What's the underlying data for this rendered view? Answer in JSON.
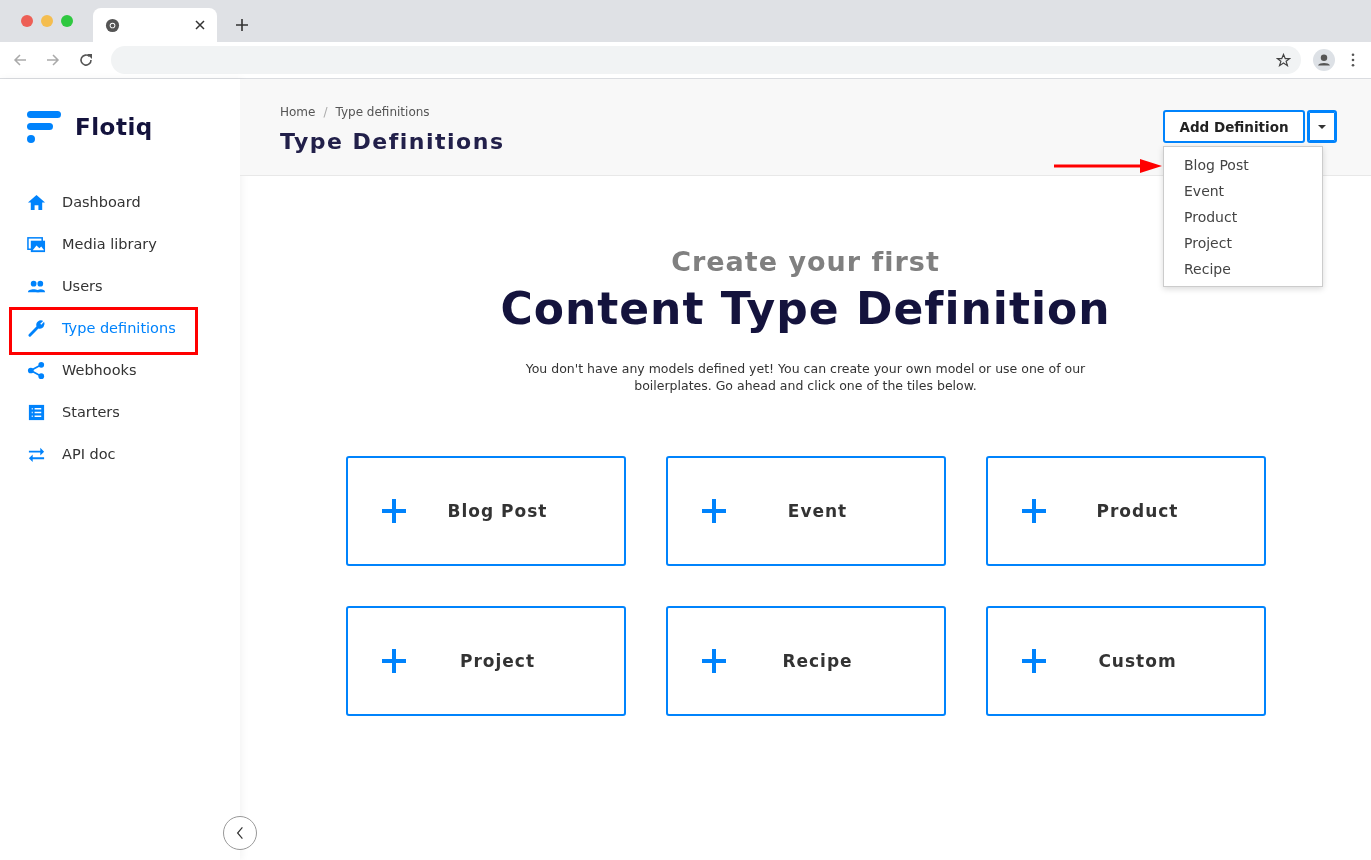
{
  "brand": {
    "name": "Flotiq"
  },
  "sidebar": {
    "items": [
      {
        "label": "Dashboard",
        "selected": false
      },
      {
        "label": "Media library",
        "selected": false
      },
      {
        "label": "Users",
        "selected": false
      },
      {
        "label": "Type definitions",
        "selected": true
      },
      {
        "label": "Webhooks",
        "selected": false
      },
      {
        "label": "Starters",
        "selected": false
      },
      {
        "label": "API doc",
        "selected": false
      }
    ]
  },
  "breadcrumbs": [
    "Home",
    "Type definitions"
  ],
  "breadcrumb_separator": "/",
  "page_title": "Type Definitions",
  "add_button": {
    "label": "Add Definition"
  },
  "dropdown": {
    "expanded": true,
    "items": [
      "Blog Post",
      "Event",
      "Product",
      "Project",
      "Recipe"
    ]
  },
  "hero": {
    "kicker": "Create your first",
    "title": "Content Type Definition",
    "description": "You don't have any models defined yet! You can create your own model or use one of our boilerplates. Go ahead and click one of the tiles below."
  },
  "tiles": [
    "Blog Post",
    "Event",
    "Product",
    "Project",
    "Recipe",
    "Custom"
  ]
}
